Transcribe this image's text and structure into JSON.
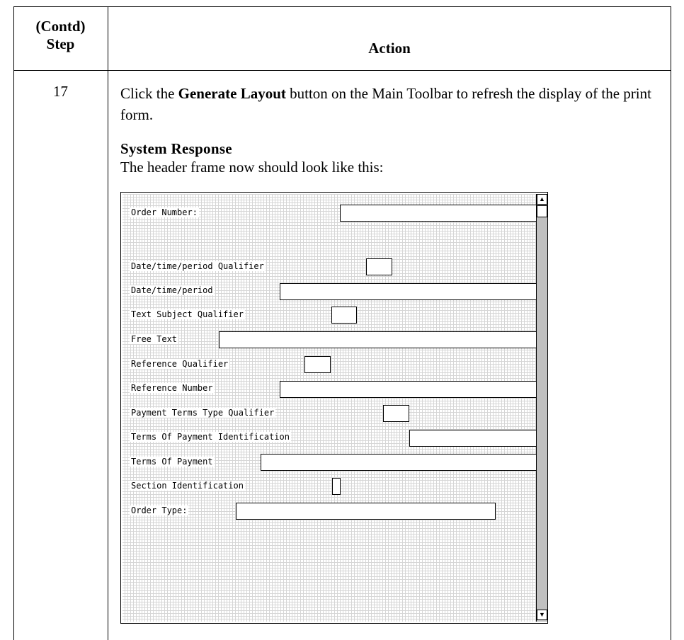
{
  "table": {
    "header": {
      "step_line1": "(Contd)",
      "step_line2": "Step",
      "action": "Action"
    },
    "row": {
      "step": "17",
      "instruction_pre": "Click the ",
      "instruction_bold": "Generate Layout",
      "instruction_post": " button on the Main Toolbar to refresh the display of the print form.",
      "system_response_title": "System Response",
      "system_response_text": "The header frame now should look like this:"
    }
  },
  "form_screenshot": {
    "fields": [
      {
        "label": "Order Number:"
      },
      {
        "label": "Date/time/period Qualifier"
      },
      {
        "label": "Date/time/period"
      },
      {
        "label": "Text Subject Qualifier"
      },
      {
        "label": "Free Text"
      },
      {
        "label": "Reference Qualifier"
      },
      {
        "label": "Reference Number"
      },
      {
        "label": "Payment Terms Type Qualifier"
      },
      {
        "label": "Terms Of Payment Identification"
      },
      {
        "label": "Terms Of Payment"
      },
      {
        "label": "Section Identification"
      },
      {
        "label": "Order Type:"
      }
    ],
    "scroll_up_icon": "arrow-up-icon",
    "scroll_down_icon": "arrow-down-icon"
  }
}
